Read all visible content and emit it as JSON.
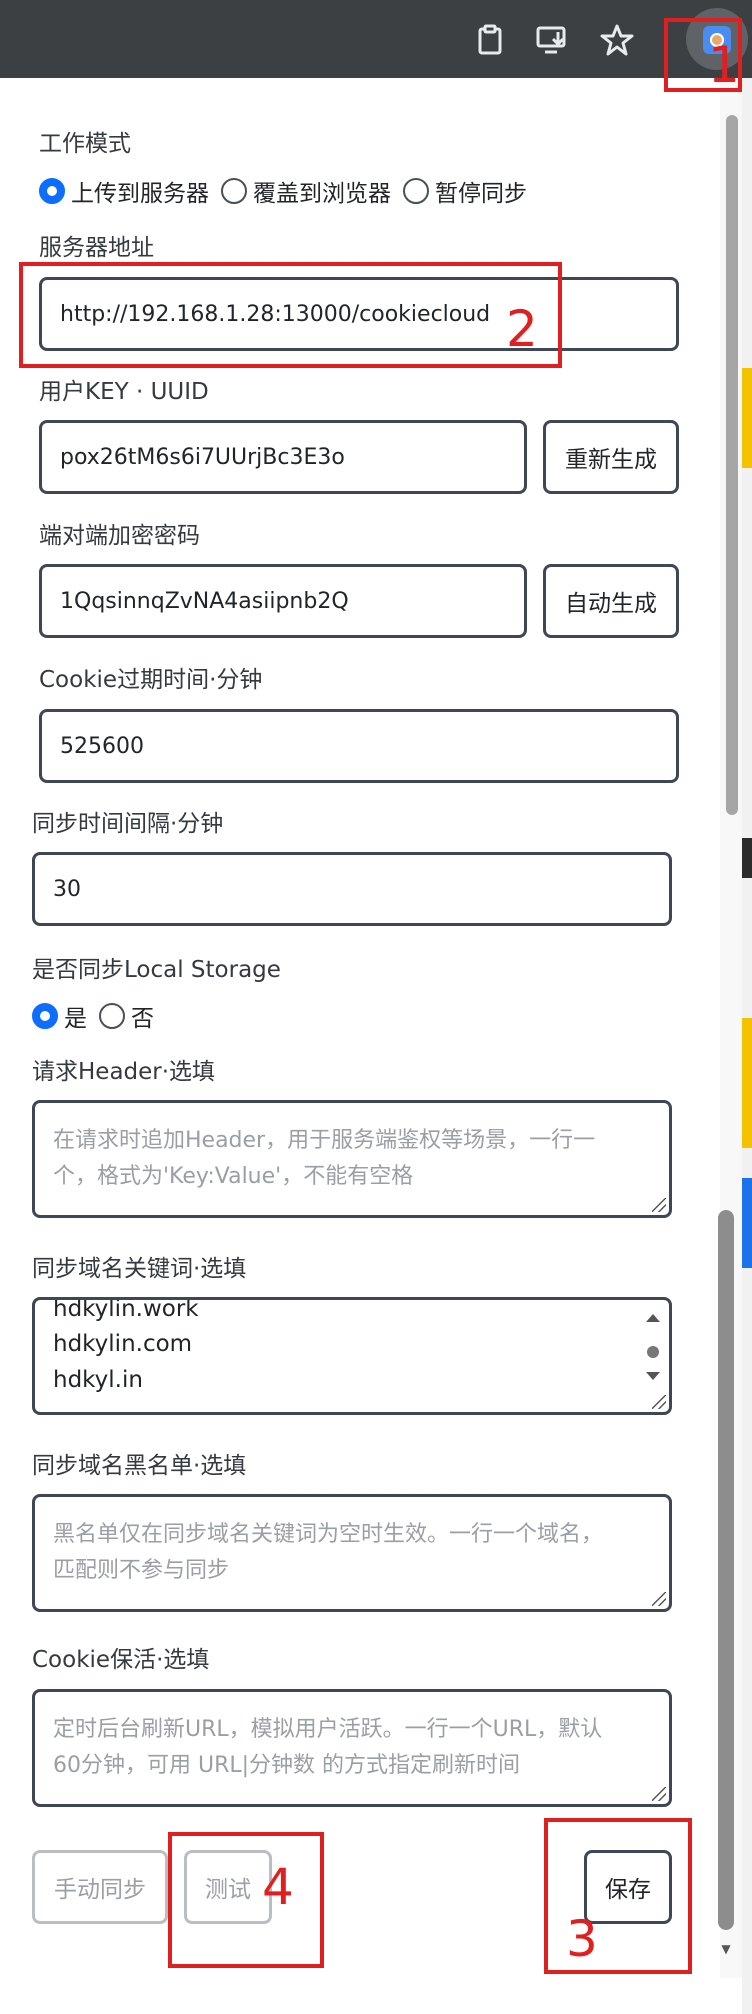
{
  "toolbar": {
    "icons": [
      "clipboard-icon",
      "install-app-icon",
      "star-icon",
      "cookiecloud-extension-icon"
    ]
  },
  "form": {
    "work_mode": {
      "label": "工作模式",
      "options": [
        "上传到服务器",
        "覆盖到浏览器",
        "暂停同步"
      ],
      "selected": "上传到服务器"
    },
    "server_address": {
      "label": "服务器地址",
      "value": "http://192.168.1.28:13000/cookiecloud"
    },
    "user_key": {
      "label": "用户KEY · UUID",
      "value": "pox26tM6s6i7UUrjBc3E3o",
      "button": "重新生成"
    },
    "e2e_password": {
      "label": "端对端加密密码",
      "value": "1QqsinnqZvNA4asiipnb2Q",
      "button": "自动生成"
    },
    "cookie_expire": {
      "label": "Cookie过期时间·分钟",
      "value": "525600"
    },
    "sync_interval": {
      "label": "同步时间间隔·分钟",
      "value": "30"
    },
    "local_storage": {
      "label": "是否同步Local Storage",
      "options": [
        "是",
        "否"
      ],
      "selected": "是"
    },
    "request_header": {
      "label": "请求Header·选填",
      "placeholder_line1": "在请求时追加Header，用于服务端鉴权等场景，一行一",
      "placeholder_line2": "个，格式为'Key:Value'，不能有空格"
    },
    "domain_keywords": {
      "label": "同步域名关键词·选填",
      "lines": [
        "hdkylin.work",
        "hdkylin.com",
        "hdkyl.in"
      ]
    },
    "domain_blacklist": {
      "label": "同步域名黑名单·选填",
      "placeholder_line1": "黑名单仅在同步域名关键词为空时生效。一行一个域名，",
      "placeholder_line2": "匹配则不参与同步"
    },
    "keepalive": {
      "label": "Cookie保活·选填",
      "placeholder_line1": "定时后台刷新URL，模拟用户活跃。一行一个URL，默认",
      "placeholder_line2": "60分钟，可用 URL|分钟数 的方式指定刷新时间"
    }
  },
  "buttons": {
    "manual_sync": "手动同步",
    "test": "测试",
    "save": "保存"
  },
  "annotations": [
    "1",
    "2",
    "3",
    "4"
  ],
  "colors": {
    "annotation": "#e02020",
    "toolbar": "#3c4043",
    "radio_checked": "#0d6efd",
    "field_border": "#3e4755"
  }
}
